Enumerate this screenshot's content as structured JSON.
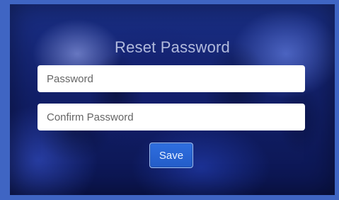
{
  "form": {
    "title": "Reset Password",
    "password_placeholder": "Password",
    "confirm_password_placeholder": "Confirm Password",
    "save_label": "Save"
  },
  "colors": {
    "outer_bg": "#3f65c3",
    "panel_bg": "#12206a",
    "button_bg": "#2f6fe0"
  }
}
